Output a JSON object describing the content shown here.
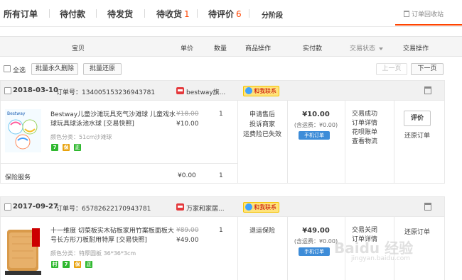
{
  "tabs": [
    {
      "label": "所有订单",
      "count": ""
    },
    {
      "label": "待付款",
      "count": ""
    },
    {
      "label": "待发货",
      "count": ""
    },
    {
      "label": "待收货",
      "count": "1"
    },
    {
      "label": "待评价",
      "count": "6"
    },
    {
      "label": "分阶段",
      "count": ""
    }
  ],
  "recycle_label": "订单回收站",
  "columns": {
    "item": "宝贝",
    "price": "单价",
    "qty": "数量",
    "item_ops": "商品操作",
    "paid": "实付款",
    "status": "交易状态",
    "ops": "交易操作"
  },
  "toolbar": {
    "select_all": "全选",
    "batch_delete": "批量永久删除",
    "batch_restore": "批量还原",
    "prev": "上一页",
    "next": "下一页"
  },
  "orders": [
    {
      "date": "2018-03-10",
      "order_no_label": "订单号：",
      "order_no": "134005153236943781",
      "shop": "bestway旗...",
      "contact": "和我联系",
      "item": {
        "title": "Bestway儿童沙滩玩具充气沙滩球 儿童戏水球玩具球泳池水球 [交易快照]",
        "thumb_text": "Bestway",
        "spec": "颜色分类：51cm沙滩球",
        "tags": [
          "7",
          "保",
          "正"
        ],
        "old_price": "¥18.00",
        "new_price": "¥10.00",
        "qty": "1",
        "ops": [
          "申请售后",
          "投诉商家",
          "运费险已失效"
        ]
      },
      "paid": "¥10.00",
      "ship": "(含运费：¥0.00)",
      "phone_order": "手机订单",
      "status": [
        "交易成功",
        "订单详情",
        "花呗账单",
        "查看物流"
      ],
      "rate_btn": "评价",
      "action": "还原订单",
      "insurance": {
        "label": "保险服务",
        "price": "¥0.00",
        "qty": "1"
      }
    },
    {
      "date": "2017-09-27",
      "order_no_label": "订单号：",
      "order_no": "65782622170943781",
      "shop": "万家和家居...",
      "contact": "和我联系",
      "item": {
        "title": "十一维度 切菜板实木砧板家用竹案板面板大号长方形刀板耐用特厚 [交易快照]",
        "spec": "颜色分类：特厚圆板 36*36*3cm",
        "tags": [
          "村",
          "7",
          "保",
          "正"
        ],
        "old_price": "¥89.00",
        "new_price": "¥49.00",
        "qty": "1",
        "ops": [
          "退运保险"
        ]
      },
      "paid": "¥49.00",
      "ship": "(含运费：¥0.00)",
      "phone_order": "手机订单",
      "status": [
        "交易关闭",
        "订单详情"
      ],
      "action": "还原订单"
    }
  ],
  "watermark": {
    "main": "Baidu 经验",
    "sub": "jingyan.baidu.com"
  },
  "colors": {
    "accent": "#ff4400",
    "phone_badge": "#3d8cd8",
    "tag_green": "#2fb82f",
    "tag_gold": "#e8a20c"
  }
}
